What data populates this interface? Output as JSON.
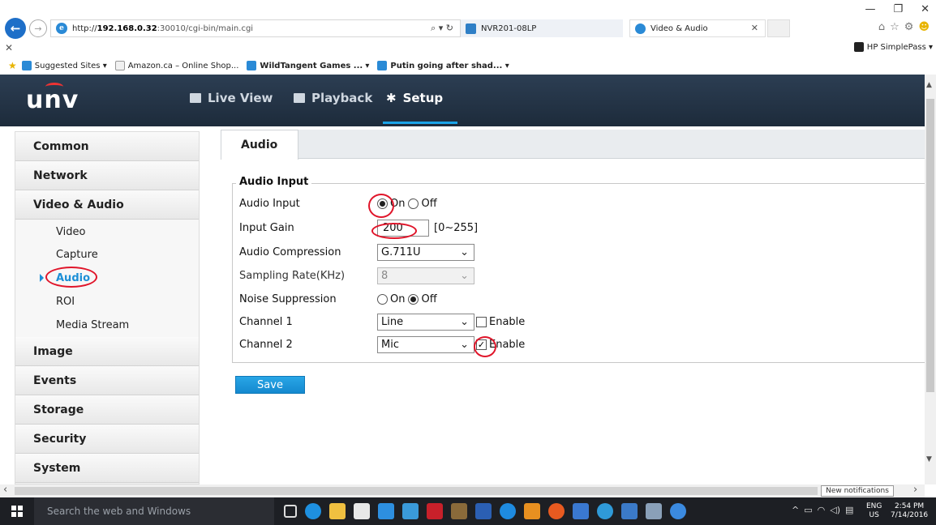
{
  "browser": {
    "url_prefix": "http://",
    "url_host": "192.168.0.32",
    "url_path": ":30010/cgi-bin/main.cgi",
    "addr_tools": "⌕ ▾ ↻",
    "tab1_title": "NVR201-08LP",
    "tab2_title": "Video & Audio",
    "tab_close": "✕",
    "win_minimize": "—",
    "win_restore": "❐",
    "win_close": "✕",
    "x_mark": "✕",
    "hp_simplepass": "HP SimplePass ▾",
    "favorites": {
      "suggested": "Suggested Sites ▾",
      "amazon": "Amazon.ca – Online Shop...",
      "wildtangent": "WildTangent Games ...",
      "wildtangent_arrow": "▾",
      "putin": "Putin going after shad... ▾"
    }
  },
  "header": {
    "logo": "UNV",
    "nav": {
      "live_view": "Live View",
      "playback": "Playback",
      "setup": "Setup"
    }
  },
  "sidebar": {
    "common": "Common",
    "network": "Network",
    "video_audio": "Video & Audio",
    "video": "Video",
    "capture": "Capture",
    "audio": "Audio",
    "roi": "ROI",
    "media_stream": "Media Stream",
    "image": "Image",
    "events": "Events",
    "storage": "Storage",
    "security": "Security",
    "system": "System"
  },
  "content": {
    "tab_audio": "Audio",
    "legend": "Audio Input",
    "fields": {
      "audio_input_label": "Audio Input",
      "audio_input_on": "On",
      "audio_input_off": "Off",
      "input_gain_label": "Input Gain",
      "input_gain_value": "200",
      "input_gain_range": "[0~255]",
      "compression_label": "Audio Compression",
      "compression_value": "G.711U",
      "sampling_label": "Sampling Rate(KHz)",
      "sampling_value": "8",
      "noise_label": "Noise Suppression",
      "noise_on": "On",
      "noise_off": "Off",
      "channel1_label": "Channel 1",
      "channel1_value": "Line",
      "channel1_enable": "Enable",
      "channel2_label": "Channel 2",
      "channel2_value": "Mic",
      "channel2_enable": "Enable"
    },
    "save": "Save"
  },
  "status": {
    "new_notifications": "New notifications"
  },
  "taskbar": {
    "search_placeholder": "Search the web and Windows",
    "lang_1": "ENG",
    "lang_2": "US",
    "time": "2:54 PM",
    "date": "7/14/2016"
  },
  "colors": {
    "accent": "#1aa3e8",
    "header_bg": "#1d2b3b",
    "annotation_red": "#e0152a",
    "save_button": "#1489cf"
  }
}
